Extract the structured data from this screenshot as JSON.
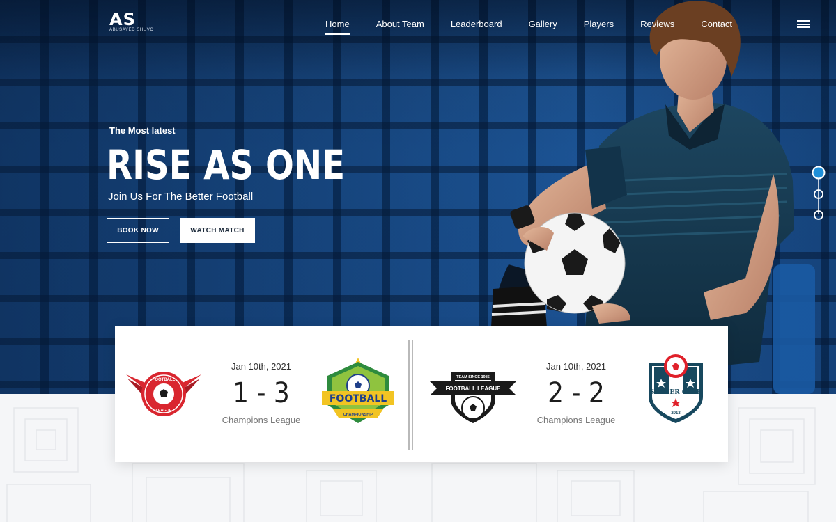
{
  "brand": {
    "logo_mark": "AS",
    "logo_sub": "ABUSAYED SHUVO"
  },
  "nav": {
    "items": [
      {
        "label": "Home",
        "active": true
      },
      {
        "label": "About Team",
        "active": false
      },
      {
        "label": "Leaderboard",
        "active": false
      },
      {
        "label": "Gallery",
        "active": false
      },
      {
        "label": "Players",
        "active": false
      },
      {
        "label": "Reviews",
        "active": false
      },
      {
        "label": "Contact",
        "active": false
      }
    ],
    "menu_icon": "hamburger-icon"
  },
  "hero": {
    "eyebrow": "The Most latest",
    "headline": "RISE AS ONE",
    "subline": "Join Us For The Better Football",
    "book_label": "BOOK NOW",
    "watch_label": "WATCH MATCH"
  },
  "slider": {
    "dots": 3,
    "active_index": 0
  },
  "matches": [
    {
      "date": "Jan 10th, 2021",
      "score": "1 - 3",
      "league": "Champions League",
      "home_badge": {
        "top_text": "FOOTBALL",
        "bottom_text": "LEAGUE"
      },
      "away_badge": {
        "main_text": "FOOTBALL",
        "sub_text": "CHAMPIONSHIP"
      }
    },
    {
      "date": "Jan 10th, 2021",
      "score": "2 - 2",
      "league": "Champions League",
      "home_badge": {
        "top_text": "TEAM SINCE 1985",
        "main_text": "FOOTBALL LEAGUE"
      },
      "away_badge": {
        "main_text": "SOCCER CLUB",
        "sub_text": "2013"
      }
    }
  ],
  "colors": {
    "accent": "#1f8fd8",
    "hero_blue": "#10437a",
    "red_badge": "#d9262f",
    "yellow_badge": "#f2c423",
    "navy_badge": "#17485e"
  }
}
